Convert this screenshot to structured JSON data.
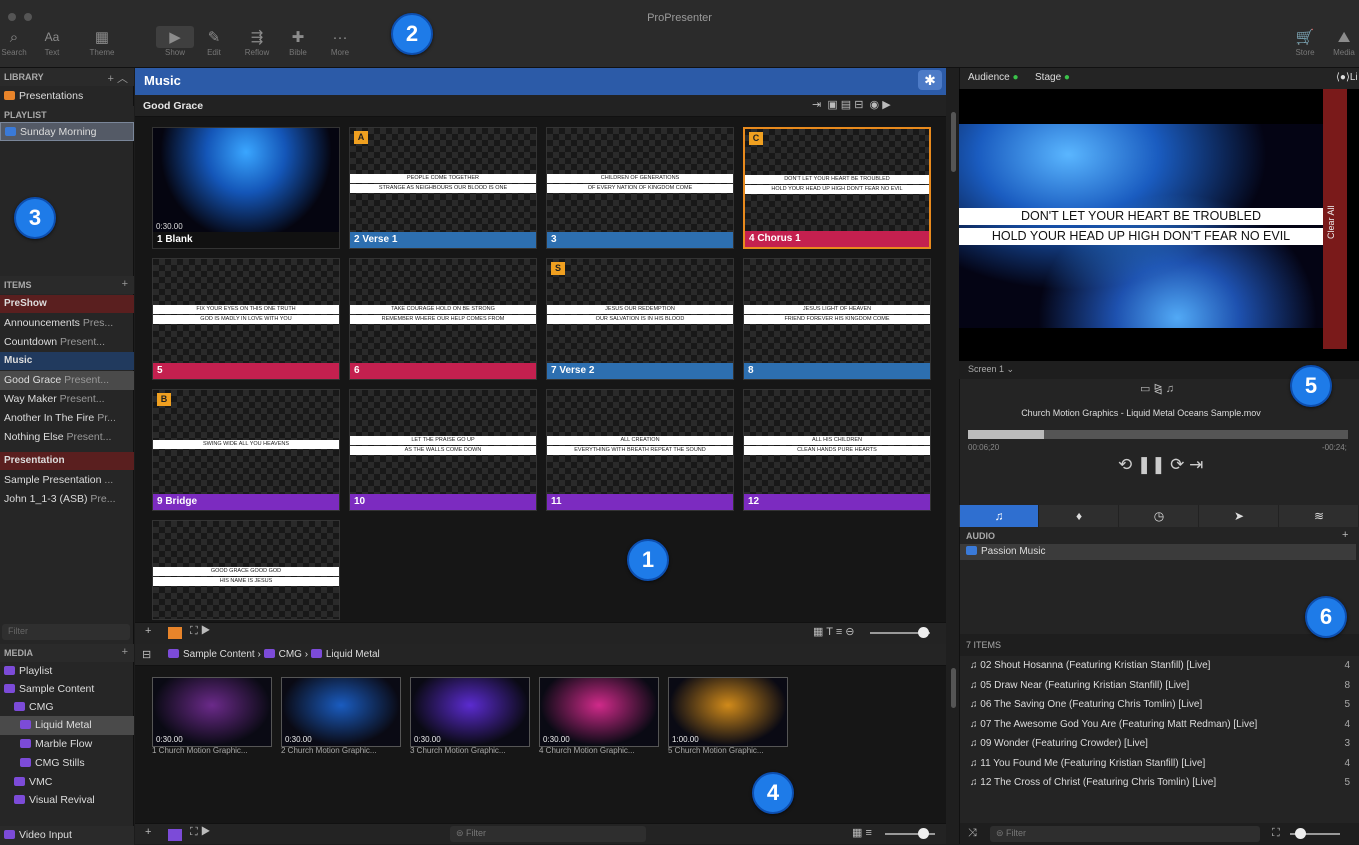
{
  "app": {
    "title": "ProPresenter"
  },
  "toolbar": {
    "search": "Search",
    "text": "Text",
    "theme": "Theme",
    "show": "Show",
    "edit": "Edit",
    "reflow": "Reflow",
    "bible": "Bible",
    "more": "More",
    "store": "Store",
    "media": "Media"
  },
  "library": {
    "header": "LIBRARY",
    "presentations": "Presentations",
    "playlist_header": "PLAYLIST",
    "sunday_morning": "Sunday Morning"
  },
  "items": {
    "header": "ITEMS",
    "groups": [
      {
        "name": "PreShow",
        "color": "#5a1f1f"
      },
      {
        "name": "Music",
        "color": "#213a5e"
      },
      {
        "name": "Presentation",
        "color": "#5a1f1f"
      }
    ],
    "rows": [
      {
        "title": "Announcements",
        "sub": "Pres..."
      },
      {
        "title": "Countdown",
        "sub": "Present..."
      },
      {
        "title": "Good Grace",
        "sub": "Present..."
      },
      {
        "title": "Way Maker",
        "sub": "Present..."
      },
      {
        "title": "Another In The Fire",
        "sub": "Pr..."
      },
      {
        "title": "Nothing Else",
        "sub": "Present..."
      },
      {
        "title": "Sample Presentation",
        "sub": "..."
      },
      {
        "title": "John 1_1-3 (ASB)",
        "sub": "Pre..."
      }
    ],
    "filter": "Filter"
  },
  "media_lib": {
    "header": "MEDIA",
    "items": [
      "Playlist",
      "Sample Content",
      "CMG",
      "Liquid Metal",
      "Marble Flow",
      "CMG Stills",
      "VMC",
      "Visual Revival"
    ],
    "video_input": "Video Input"
  },
  "music": {
    "header": "Music",
    "doc_title": "Good Grace",
    "slides": [
      {
        "label": "1  Blank",
        "tag": "",
        "color": "black",
        "l1": "",
        "l2": "",
        "time": "0:30.00"
      },
      {
        "label": "2  Verse 1",
        "tag": "A",
        "color": "blue",
        "l1": "PEOPLE COME TOGETHER",
        "l2": "STRANGE AS NEIGHBOURS OUR BLOOD IS ONE",
        "time": ""
      },
      {
        "label": "3",
        "tag": "",
        "color": "blue",
        "l1": "CHILDREN OF GENERATIONS",
        "l2": "OF EVERY NATION OF KINGDOM COME",
        "time": ""
      },
      {
        "label": "4  Chorus 1",
        "tag": "C",
        "color": "red",
        "l1": "DON'T LET YOUR HEART BE TROUBLED",
        "l2": "HOLD YOUR HEAD UP HIGH DON'T FEAR NO EVIL",
        "time": ""
      },
      {
        "label": "5",
        "tag": "",
        "color": "red",
        "l1": "FIX YOUR EYES ON THIS ONE TRUTH",
        "l2": "GOD IS MADLY IN LOVE WITH YOU",
        "time": ""
      },
      {
        "label": "6",
        "tag": "",
        "color": "red",
        "l1": "TAKE COURAGE HOLD ON BE STRONG",
        "l2": "REMEMBER WHERE OUR HELP COMES FROM",
        "time": ""
      },
      {
        "label": "7  Verse 2",
        "tag": "S",
        "color": "blue",
        "l1": "JESUS OUR REDEMPTION",
        "l2": "OUR SALVATION IS IN HIS BLOOD",
        "time": ""
      },
      {
        "label": "8",
        "tag": "",
        "color": "blue",
        "l1": "JESUS LIGHT OF HEAVEN",
        "l2": "FRIEND FOREVER HIS KINGDOM COME",
        "time": ""
      },
      {
        "label": "9  Bridge",
        "tag": "B",
        "color": "purple",
        "l1": "SWING WIDE ALL YOU HEAVENS",
        "l2": "",
        "time": ""
      },
      {
        "label": "10",
        "tag": "",
        "color": "purple",
        "l1": "LET THE PRAISE GO UP",
        "l2": "AS THE WALLS COME DOWN",
        "time": ""
      },
      {
        "label": "11",
        "tag": "",
        "color": "purple",
        "l1": "ALL CREATION",
        "l2": "EVERYTHING WITH BREATH REPEAT THE SOUND",
        "time": ""
      },
      {
        "label": "12",
        "tag": "",
        "color": "purple",
        "l1": "ALL HIS CHILDREN",
        "l2": "CLEAN HANDS PURE HEARTS",
        "time": ""
      },
      {
        "label": "",
        "tag": "",
        "color": "purple",
        "l1": "GOOD GRACE GOOD GOD",
        "l2": "HIS NAME IS JESUS",
        "time": ""
      }
    ]
  },
  "media_bin": {
    "breadcrumb": [
      "Sample Content",
      "CMG",
      "Liquid Metal"
    ],
    "items": [
      {
        "caption": "1 Church Motion Graphic...",
        "time": "0:30.00",
        "bg": "#6b2a8a"
      },
      {
        "caption": "2 Church Motion Graphic...",
        "time": "0:30.00",
        "bg": "#1a5cc0"
      },
      {
        "caption": "3 Church Motion Graphic...",
        "time": "0:30.00",
        "bg": "#5b2bd0"
      },
      {
        "caption": "4 Church Motion Graphic...",
        "time": "0:30.00",
        "bg": "#d02a8a"
      },
      {
        "caption": "5 Church Motion Graphic...",
        "time": "1:00.00",
        "bg": "#d08a1a"
      }
    ],
    "filter": "Filter"
  },
  "output": {
    "audience": "Audience",
    "stage": "Stage",
    "live": "Li",
    "line1": "DON'T LET YOUR HEART BE TROUBLED",
    "line2": "HOLD YOUR HEAD UP HIGH DON'T FEAR NO EVIL",
    "clear_all": "Clear All",
    "screen": "Screen 1",
    "media_name": "Church Motion Graphics - Liquid Metal Oceans Sample.mov",
    "elapsed": "00:06;20",
    "remaining": "-00:24;",
    "progress": 0.2
  },
  "audio": {
    "header": "AUDIO",
    "playlist": "Passion Music",
    "count": "7 ITEMS",
    "tracks": [
      {
        "title": "02 Shout Hosanna (Featuring Kristian Stanfill) [Live]",
        "n": "4"
      },
      {
        "title": "05 Draw Near (Featuring Kristian Stanfill) [Live]",
        "n": "8"
      },
      {
        "title": "06 The Saving One (Featuring Chris Tomlin) [Live]",
        "n": "5"
      },
      {
        "title": "07 The Awesome God You Are (Featuring Matt Redman) [Live]",
        "n": "4"
      },
      {
        "title": "09 Wonder (Featuring Crowder) [Live]",
        "n": "3"
      },
      {
        "title": "11 You Found Me (Featuring Kristian Stanfill) [Live]",
        "n": "4"
      },
      {
        "title": "12 The Cross of Christ (Featuring Chris Tomlin) [Live]",
        "n": "5"
      }
    ],
    "filter": "Filter"
  },
  "callouts": [
    "1",
    "2",
    "3",
    "4",
    "5",
    "6"
  ]
}
